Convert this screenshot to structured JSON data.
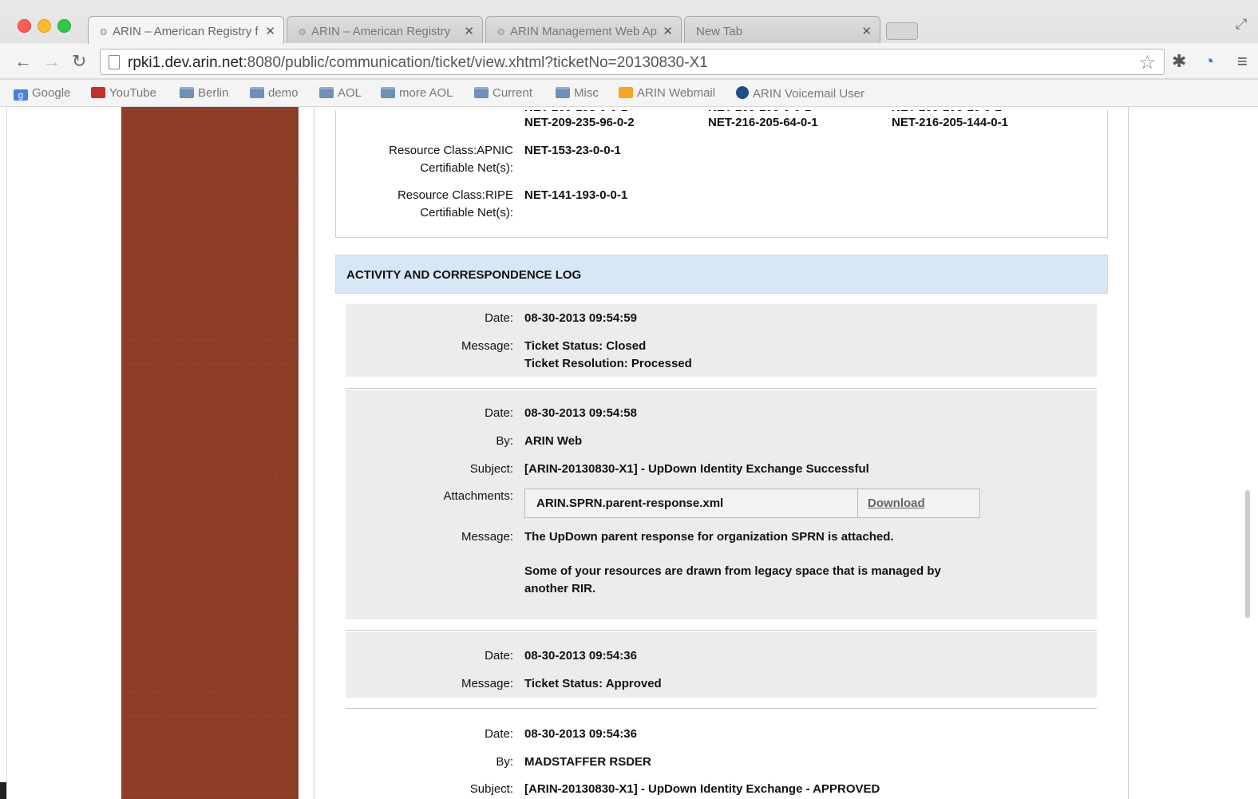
{
  "tabs": [
    {
      "label": "ARIN – American Registry f",
      "active": true
    },
    {
      "label": "ARIN – American Registry",
      "active": false
    },
    {
      "label": "ARIN Management Web Ap",
      "active": false
    },
    {
      "label": "New Tab",
      "active": false
    }
  ],
  "address_bar": {
    "host": "rpki1.dev.arin.net",
    "path": ":8080/public/communication/ticket/view.xhtml?ticketNo=20130830-X1"
  },
  "bookmarks": [
    "Google",
    "YouTube",
    "Berlin",
    "demo",
    "AOL",
    "more AOL",
    "Current",
    "Misc",
    "ARIN Webmail",
    "ARIN Voicemail User"
  ],
  "resources": {
    "top_nets": [
      "NET-209-235-96-0-2",
      "NET-216-205-64-0-1",
      "NET-216-205-144-0-1"
    ],
    "apnic_label_1": "Resource Class:APNIC",
    "apnic_label_2": "Certifiable Net(s):",
    "apnic_value": "NET-153-23-0-0-1",
    "ripe_label_1": "Resource Class:RIPE",
    "ripe_label_2": "Certifiable Net(s):",
    "ripe_value": "NET-141-193-0-0-1"
  },
  "log": {
    "title": "ACTIVITY AND CORRESPONDENCE LOG",
    "labels": {
      "date": "Date:",
      "by": "By:",
      "subject": "Subject:",
      "attachments": "Attachments:",
      "message": "Message:"
    },
    "entry1": {
      "date": "08-30-2013 09:54:59",
      "message_1": "Ticket Status: Closed",
      "message_2": "Ticket Resolution: Processed"
    },
    "entry2": {
      "date": "08-30-2013 09:54:58",
      "by": "ARIN Web",
      "subject": "[ARIN-20130830-X1] - UpDown Identity Exchange Successful",
      "attachment_name": "ARIN.SPRN.parent-response.xml",
      "download": "Download",
      "message_1": "The UpDown parent response for organization SPRN is attached.",
      "message_2": "Some of your resources are drawn from legacy space that is managed by",
      "message_3": "another RIR."
    },
    "entry3": {
      "date": "08-30-2013 09:54:36",
      "message": "Ticket Status: Approved"
    },
    "entry4": {
      "date": "08-30-2013 09:54:36",
      "by": "MADSTAFFER RSDER",
      "subject": "[ARIN-20130830-X1] - UpDown Identity Exchange - APPROVED"
    }
  }
}
